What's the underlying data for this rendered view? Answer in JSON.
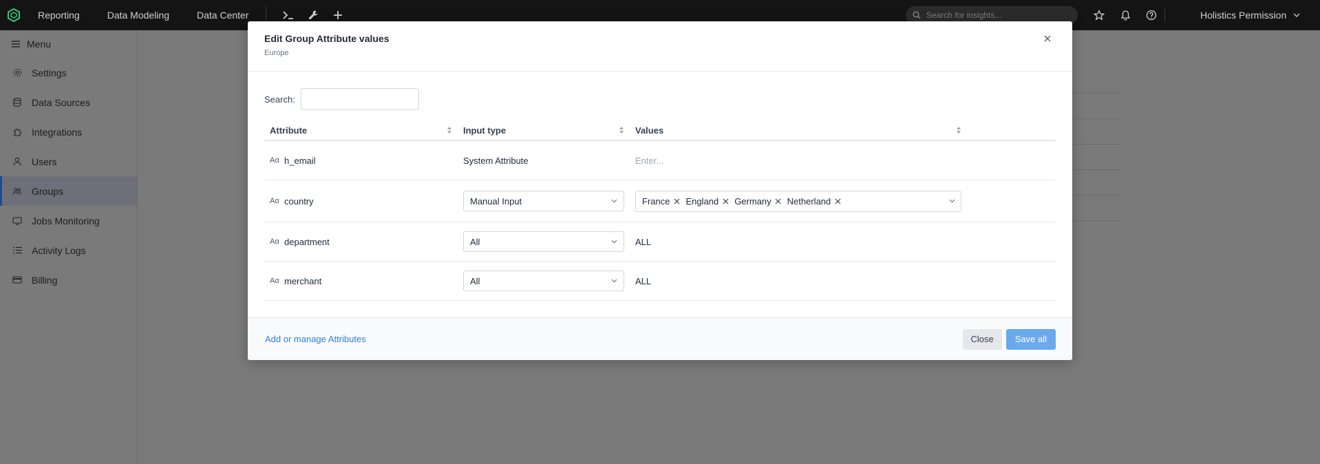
{
  "topbar": {
    "nav": [
      "Reporting",
      "Data Modeling",
      "Data Center"
    ],
    "search_placeholder": "Search for insights...",
    "workspace": "Holistics Permission"
  },
  "sidebar": {
    "menu_label": "Menu",
    "items": [
      {
        "label": "Settings",
        "icon": "gear-icon"
      },
      {
        "label": "Data Sources",
        "icon": "database-icon"
      },
      {
        "label": "Integrations",
        "icon": "puzzle-icon"
      },
      {
        "label": "Users",
        "icon": "user-icon"
      },
      {
        "label": "Groups",
        "icon": "group-icon",
        "active": true
      },
      {
        "label": "Jobs Monitoring",
        "icon": "monitor-icon"
      },
      {
        "label": "Activity Logs",
        "icon": "list-icon"
      },
      {
        "label": "Billing",
        "icon": "card-icon"
      }
    ]
  },
  "modal": {
    "title": "Edit Group Attribute values",
    "subtitle": "Europe",
    "search_label": "Search:",
    "columns": {
      "attribute": "Attribute",
      "input_type": "Input type",
      "values": "Values"
    },
    "rows": [
      {
        "attribute": "h_email",
        "input_type": "System Attribute",
        "input_kind": "text",
        "value_kind": "placeholder",
        "value": "Enter..."
      },
      {
        "attribute": "country",
        "input_type": "Manual Input",
        "input_kind": "select",
        "value_kind": "tags",
        "tags": [
          "France",
          "England",
          "Germany",
          "Netherland"
        ]
      },
      {
        "attribute": "department",
        "input_type": "All",
        "input_kind": "select",
        "value_kind": "text",
        "value": "ALL"
      },
      {
        "attribute": "merchant",
        "input_type": "All",
        "input_kind": "select",
        "value_kind": "text",
        "value": "ALL"
      }
    ],
    "footer_link": "Add or manage Attributes",
    "close_label": "Close",
    "save_label": "Save all"
  },
  "colors": {
    "topbar_bg": "#141414",
    "accent": "#2f7de1",
    "save_button": "#6aa9ec",
    "overlay": "#7a7a7a"
  }
}
